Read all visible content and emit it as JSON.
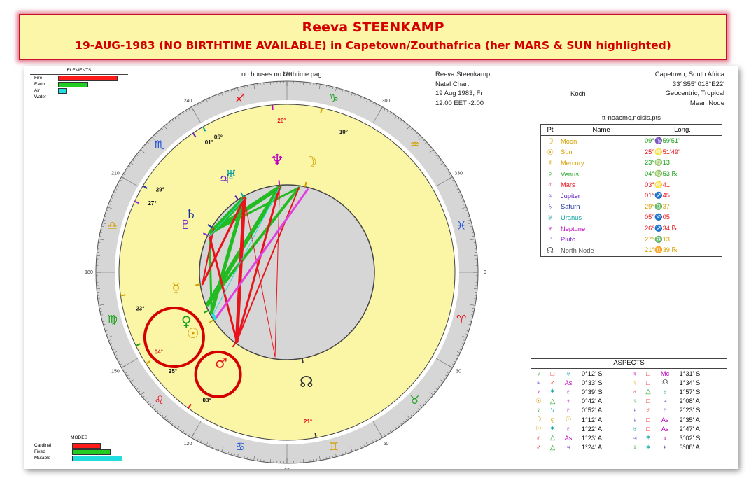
{
  "banner": {
    "title": "Reeva STEENKAMP",
    "subtitle": "19-AUG-1983 (NO BIRTHTIME AVAILABLE) in Capetown/Zouthafrica (her MARS & SUN highlighted)"
  },
  "header": {
    "file": "no houses no birthtime.pag",
    "name": "Reeva Steenkamp",
    "chart_type": "Natal Chart",
    "date": "19 Aug 1983, Fr",
    "time": "12:00 EET -2:00",
    "house_system": "Koch",
    "place": "Capetown, South Africa",
    "coords": "33°S55' 018°E22'",
    "zodiac": "Geocentric, Tropical",
    "node": "Mean Node"
  },
  "elements": {
    "title": "ELEMENTS",
    "rows": [
      {
        "label": "Fire",
        "value": 0.85,
        "color": "#ff1a1a"
      },
      {
        "label": "Earth",
        "value": 0.42,
        "color": "#22cc22"
      },
      {
        "label": "Air",
        "value": 0.11,
        "color": "#22dddd"
      },
      {
        "label": "Water",
        "value": 0,
        "color": "#ffffff"
      }
    ]
  },
  "modes": {
    "title": "MODES",
    "rows": [
      {
        "label": "Cardinal",
        "value": 0.5,
        "color": "#ff1a1a"
      },
      {
        "label": "Fixed",
        "value": 0.68,
        "color": "#22cc22"
      },
      {
        "label": "Mutable",
        "value": 0.9,
        "color": "#22dddd"
      }
    ]
  },
  "wheel": {
    "degree_labels": [
      {
        "deg": 0,
        "label": "0"
      },
      {
        "deg": 30,
        "label": "30"
      },
      {
        "deg": 60,
        "label": "60"
      },
      {
        "deg": 90,
        "label": "90"
      },
      {
        "deg": 120,
        "label": "120"
      },
      {
        "deg": 150,
        "label": "150"
      },
      {
        "deg": 180,
        "label": "180"
      },
      {
        "deg": 210,
        "label": "210"
      },
      {
        "deg": 240,
        "label": "240"
      },
      {
        "deg": 270,
        "label": "270"
      },
      {
        "deg": 300,
        "label": "300"
      },
      {
        "deg": 330,
        "label": "330"
      }
    ],
    "signs": [
      {
        "deg": 15,
        "glyph": "♈",
        "color": "#e8131b"
      },
      {
        "deg": 45,
        "glyph": "♉",
        "color": "#1aa01a"
      },
      {
        "deg": 75,
        "glyph": "♊",
        "color": "#d4a000"
      },
      {
        "deg": 105,
        "glyph": "♋",
        "color": "#1a4fd6"
      },
      {
        "deg": 135,
        "glyph": "♌",
        "color": "#e8131b"
      },
      {
        "deg": 165,
        "glyph": "♍",
        "color": "#1aa01a"
      },
      {
        "deg": 195,
        "glyph": "♎",
        "color": "#d4a000"
      },
      {
        "deg": 225,
        "glyph": "♏",
        "color": "#1a4fd6"
      },
      {
        "deg": 255,
        "glyph": "♐",
        "color": "#e8131b"
      },
      {
        "deg": 285,
        "glyph": "♑",
        "color": "#1aa01a"
      },
      {
        "deg": 315,
        "glyph": "♒",
        "color": "#d4a000"
      },
      {
        "deg": 345,
        "glyph": "♓",
        "color": "#1a4fd6"
      }
    ],
    "planets": [
      {
        "name": "Moon",
        "glyph": "☽",
        "deg": 282,
        "color": "#d4a000",
        "label": "10°",
        "label_deg": 292,
        "size": 22
      },
      {
        "name": "Neptune",
        "glyph": "♆",
        "deg": 265,
        "color": "#c000c0",
        "label": "26°",
        "label_deg": 268,
        "size": 22
      },
      {
        "name": "Uranus",
        "glyph": "♅",
        "deg": 240,
        "color": "#0aa0a0",
        "label": "05°",
        "label_deg": 243,
        "size": 18
      },
      {
        "name": "Jupiter",
        "glyph": "♃",
        "deg": 236,
        "color": "#6020c0",
        "label": "01°",
        "label_deg": 239,
        "size": 18
      },
      {
        "name": "Saturn",
        "glyph": "♄",
        "deg": 211,
        "color": "#1a2fa0",
        "label": "29°",
        "label_deg": 213,
        "size": 18
      },
      {
        "name": "Pluto",
        "glyph": "♇",
        "deg": 205,
        "color": "#8a2bd0",
        "label": "27°",
        "label_deg": 207,
        "size": 18
      },
      {
        "name": "Mercury",
        "glyph": "☿",
        "deg": 172,
        "color": "#d4a000",
        "label": "23°",
        "label_deg": 166,
        "size": 20
      },
      {
        "name": "Venus",
        "glyph": "♀",
        "deg": 154,
        "color": "#1aa01a",
        "label": "04°",
        "label_deg": 148,
        "size": 20
      },
      {
        "name": "Sun",
        "glyph": "☉",
        "deg": 147,
        "color": "#d4a000",
        "label": "25°",
        "label_deg": 139,
        "size": 20
      },
      {
        "name": "Mars",
        "glyph": "♂",
        "deg": 126,
        "color": "#e8131b",
        "label": "03°",
        "label_deg": 122,
        "size": 20
      },
      {
        "name": "North Node",
        "glyph": "☊",
        "deg": 80,
        "color": "#333333",
        "label": "21°",
        "label_deg": 82,
        "size": 22
      }
    ],
    "highlights": [
      {
        "name": "Sun & Venus",
        "deg": 150,
        "label": "sun-venus-highlight"
      },
      {
        "name": "Mars",
        "deg": 124,
        "label": "mars-highlight"
      }
    ]
  },
  "planet_table": {
    "title": "tt-noacmc,noisis.pts",
    "columns": [
      "Pt",
      "Name",
      "Long."
    ],
    "rows": [
      {
        "glyph": "☽",
        "name": "Moon",
        "long": "09°♑59'51\"",
        "color": "#d4a000",
        "lcolor": "#1aa01a"
      },
      {
        "glyph": "☉",
        "name": "Sun",
        "long": "25°♌51'49\"",
        "color": "#d4a000",
        "lcolor": "#e8131b"
      },
      {
        "glyph": "☿",
        "name": "Mercury",
        "long": "23°♍13",
        "color": "#d4a000",
        "lcolor": "#1aa01a"
      },
      {
        "glyph": "♀",
        "name": "Venus",
        "long": "04°♍53 ℞",
        "color": "#1aa01a",
        "lcolor": "#1aa01a"
      },
      {
        "glyph": "♂",
        "name": "Mars",
        "long": "03°♌41",
        "color": "#e8131b",
        "lcolor": "#e8131b"
      },
      {
        "glyph": "♃",
        "name": "Jupiter",
        "long": "01°♐45",
        "color": "#6020c0",
        "lcolor": "#e8131b"
      },
      {
        "glyph": "♄",
        "name": "Saturn",
        "long": "29°♎37",
        "color": "#1a2fa0",
        "lcolor": "#d4a000"
      },
      {
        "glyph": "♅",
        "name": "Uranus",
        "long": "05°♐05",
        "color": "#0aa0a0",
        "lcolor": "#e8131b"
      },
      {
        "glyph": "♆",
        "name": "Neptune",
        "long": "26°♐34 ℞",
        "color": "#c000c0",
        "lcolor": "#e8131b"
      },
      {
        "glyph": "♇",
        "name": "Pluto",
        "long": "27°♎13",
        "color": "#8a2bd0",
        "lcolor": "#d4a000"
      },
      {
        "glyph": "☊",
        "name": "North Node",
        "long": "21°♊39 ℞",
        "color": "#555555",
        "lcolor": "#d4a000"
      }
    ]
  },
  "aspects": {
    "title": "ASPECTS",
    "rows": [
      {
        "a": "♀",
        "ac": "#1aa01a",
        "asp": "□",
        "aspc": "#e8131b",
        "b": "♅",
        "bc": "#0aa0a0",
        "orb": "0°12' S",
        "a2": "♆",
        "a2c": "#c000c0",
        "asp2": "□",
        "asp2c": "#e8131b",
        "b2": "Mc",
        "b2c": "#c000c0",
        "orb2": "1°31' S"
      },
      {
        "a": "♃",
        "ac": "#6020c0",
        "asp": "♂",
        "aspc": "#e8131b",
        "b": "As",
        "bc": "#c000c0",
        "orb": "0°33' S",
        "a2": "☿",
        "a2c": "#d4a000",
        "asp2": "□",
        "asp2c": "#e8131b",
        "b2": "☊",
        "b2c": "#555555",
        "orb2": "1°34' S"
      },
      {
        "a": "♆",
        "ac": "#c000c0",
        "asp": "✶",
        "aspc": "#0aa0a0",
        "b": "♇",
        "bc": "#8a2bd0",
        "orb": "0°39' S",
        "a2": "♂",
        "a2c": "#e8131b",
        "asp2": "△",
        "asp2c": "#1aa01a",
        "b2": "♅",
        "b2c": "#0aa0a0",
        "orb2": "1°57' S"
      },
      {
        "a": "☉",
        "ac": "#d4a000",
        "asp": "△",
        "aspc": "#1aa01a",
        "b": "♆",
        "bc": "#c000c0",
        "orb": "0°42' A",
        "a2": "♀",
        "a2c": "#1aa01a",
        "asp2": "□",
        "asp2c": "#e8131b",
        "b2": "♃",
        "b2c": "#6020c0",
        "orb2": "2°08' A"
      },
      {
        "a": "♀",
        "ac": "#1aa01a",
        "asp": "⚺",
        "aspc": "#0aa0a0",
        "b": "♇",
        "bc": "#8a2bd0",
        "orb": "0°52' A",
        "a2": "♄",
        "a2c": "#1a2fa0",
        "asp2": "♂",
        "asp2c": "#e8131b",
        "b2": "♇",
        "b2c": "#8a2bd0",
        "orb2": "2°23' S"
      },
      {
        "a": "☽",
        "ac": "#d4a000",
        "asp": "⚼",
        "aspc": "#d4a000",
        "b": "☉",
        "bc": "#d4a000",
        "orb": "1°12' A",
        "a2": "♄",
        "a2c": "#1a2fa0",
        "asp2": "□",
        "asp2c": "#e8131b",
        "b2": "As",
        "b2c": "#c000c0",
        "orb2": "2°35' A"
      },
      {
        "a": "☉",
        "ac": "#d4a000",
        "asp": "✶",
        "aspc": "#0aa0a0",
        "b": "♇",
        "bc": "#8a2bd0",
        "orb": "1°22' A",
        "a2": "♅",
        "a2c": "#0aa0a0",
        "asp2": "□",
        "asp2c": "#e8131b",
        "b2": "As",
        "b2c": "#c000c0",
        "orb2": "2°47' A"
      },
      {
        "a": "♂",
        "ac": "#e8131b",
        "asp": "△",
        "aspc": "#1aa01a",
        "b": "As",
        "bc": "#c000c0",
        "orb": "1°23' A",
        "a2": "♃",
        "a2c": "#6020c0",
        "asp2": "✶",
        "asp2c": "#0aa0a0",
        "b2": "♆",
        "b2c": "#c000c0",
        "orb2": "3°02' S"
      },
      {
        "a": "♂",
        "ac": "#e8131b",
        "asp": "△",
        "aspc": "#1aa01a",
        "b": "♃",
        "bc": "#6020c0",
        "orb": "1°24' A",
        "a2": "♀",
        "a2c": "#1aa01a",
        "asp2": "✶",
        "asp2c": "#0aa0a0",
        "b2": "♄",
        "b2c": "#1a2fa0",
        "orb2": "3°08' A"
      }
    ]
  },
  "aspect_lines": [
    {
      "from": 278,
      "to": 158,
      "color": "#22bb22",
      "w": 4
    },
    {
      "from": 265,
      "to": 158,
      "color": "#22bb22",
      "w": 6
    },
    {
      "from": 240,
      "to": 152,
      "color": "#22bb22",
      "w": 5
    },
    {
      "from": 240,
      "to": 208,
      "color": "#22bb22",
      "w": 7
    },
    {
      "from": 265,
      "to": 208,
      "color": "#22bb22",
      "w": 6
    },
    {
      "from": 278,
      "to": 208,
      "color": "#22bb22",
      "w": 3
    },
    {
      "from": 205,
      "to": 152,
      "color": "#22bb22",
      "w": 3
    },
    {
      "from": 265,
      "to": 126,
      "color": "#e8131b",
      "w": 3
    },
    {
      "from": 240,
      "to": 126,
      "color": "#e8131b",
      "w": 5
    },
    {
      "from": 278,
      "to": 126,
      "color": "#e8131b",
      "w": 2
    },
    {
      "from": 205,
      "to": 126,
      "color": "#e8131b",
      "w": 3
    },
    {
      "from": 265,
      "to": 98,
      "color": "#e8131b",
      "w": 1
    },
    {
      "from": 240,
      "to": 98,
      "color": "#e8131b",
      "w": 1
    },
    {
      "from": 240,
      "to": 172,
      "color": "#e8131b",
      "w": 3
    },
    {
      "from": 211,
      "to": 172,
      "color": "#e8131b",
      "w": 2
    },
    {
      "from": 284,
      "to": 147,
      "color": "#e040e0",
      "w": 3
    },
    {
      "from": 265,
      "to": 150,
      "color": "#22dddd",
      "w": 1
    },
    {
      "from": 240,
      "to": 205,
      "color": "#22dddd",
      "w": 1
    },
    {
      "from": 150,
      "to": 147,
      "color": "#22dddd",
      "w": 4
    }
  ]
}
